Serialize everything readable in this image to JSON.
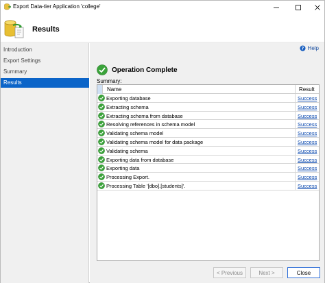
{
  "window": {
    "title": "Export Data-tier Application 'college'"
  },
  "header": {
    "title": "Results"
  },
  "sidebar": {
    "items": [
      {
        "label": "Introduction",
        "active": false
      },
      {
        "label": "Export Settings",
        "active": false
      },
      {
        "label": "Summary",
        "active": false
      },
      {
        "label": "Results",
        "active": true
      }
    ]
  },
  "main": {
    "help_label": "Help",
    "operation_title": "Operation Complete",
    "summary_label": "Summary:",
    "table": {
      "columns": [
        "Name",
        "Result"
      ],
      "rows": [
        {
          "name": "Exporting database",
          "result": "Success"
        },
        {
          "name": "Extracting schema",
          "result": "Success"
        },
        {
          "name": "Extracting schema from database",
          "result": "Success"
        },
        {
          "name": "Resolving references in schema model",
          "result": "Success"
        },
        {
          "name": "Validating schema model",
          "result": "Success"
        },
        {
          "name": "Validating schema model for data package",
          "result": "Success"
        },
        {
          "name": "Validating schema",
          "result": "Success"
        },
        {
          "name": "Exporting data from database",
          "result": "Success"
        },
        {
          "name": "Exporting data",
          "result": "Success"
        },
        {
          "name": "Processing Export.",
          "result": "Success"
        },
        {
          "name": "Processing Table '[dbo].[students]'.",
          "result": "Success"
        }
      ]
    }
  },
  "buttons": {
    "previous": "< Previous",
    "next": "Next >",
    "close": "Close"
  },
  "colors": {
    "accent": "#0b64c8",
    "success_green": "#3aa33a",
    "link": "#0645ad"
  },
  "icons": {
    "app": "database-export-icon",
    "header": "database-export-icon",
    "help": "help-icon",
    "status": "checkmark-circle-icon"
  }
}
